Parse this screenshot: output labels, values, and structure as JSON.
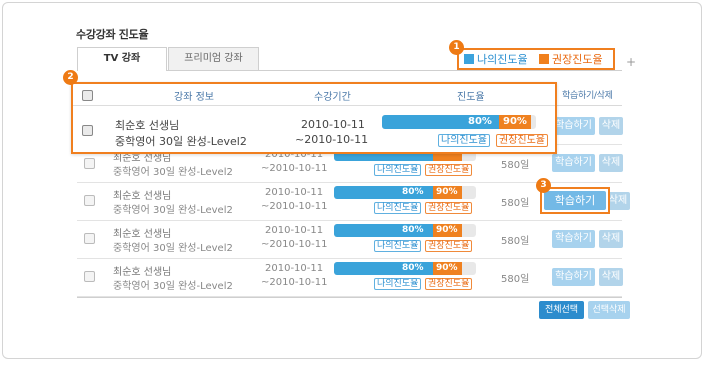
{
  "title": "수강강좌 진도율",
  "tabs": [
    {
      "label": "TV 강좌",
      "active": true
    },
    {
      "label": "프리미엄 강좌",
      "active": false
    }
  ],
  "plus": "+",
  "legend": {
    "my_progress": "나의진도율",
    "recommended_progress": "권장진도율",
    "colors": {
      "my": "#3aa3da",
      "recommended": "#ef8120"
    }
  },
  "badges": [
    "1",
    "2",
    "3"
  ],
  "columns": {
    "info": "강좌 정보",
    "period": "수강기간",
    "progress": "진도율",
    "action": "학습하기/삭제"
  },
  "highlight_row": {
    "teacher": "최순호 선생님",
    "course": "중학영어 30일 완성-Level2",
    "date_start": "2010-10-11",
    "date_end": "~2010-10-11",
    "my_pct": "80%",
    "rec_pct": "90%",
    "my_value": 0.8,
    "rec_value": 0.9,
    "tag_my": "나의진도율",
    "tag_rec": "권장진도율"
  },
  "rows": [
    {
      "teacher": "최순호 선생님",
      "course": "중학영어 30일 완성-Level2",
      "date_start": "2010-10-11",
      "date_end": "~2010-10-11",
      "my_pct": "80%",
      "rec_pct": "90%",
      "tag_my": "나의진도율",
      "tag_rec": "권장진도율",
      "price": "580일",
      "study": "학습하기",
      "delete": "삭제"
    },
    {
      "teacher": "최순호 선생님",
      "course": "중학영어 30일 완성-Level2",
      "date_start": "2010-10-11",
      "date_end": "~2010-10-11",
      "my_pct": "80%",
      "rec_pct": "90%",
      "tag_my": "나의진도율",
      "tag_rec": "권장진도율",
      "price": "580일",
      "study": "학습하기",
      "delete": "삭제"
    },
    {
      "teacher": "최순호 선생님",
      "course": "중학영어 30일 완성-Level2",
      "date_start": "2010-10-11",
      "date_end": "~2010-10-11",
      "my_pct": "80%",
      "rec_pct": "90%",
      "tag_my": "나의진도율",
      "tag_rec": "권장진도율",
      "price": "580일",
      "study": "학습하기",
      "delete": "삭제"
    },
    {
      "teacher": "최순호 선생님",
      "course": "중학영어 30일 완성-Level2",
      "date_start": "2010-10-11",
      "date_end": "~2010-10-11",
      "my_pct": "80%",
      "rec_pct": "90%",
      "tag_my": "나의진도율",
      "tag_rec": "권장진도율",
      "price": "580일",
      "study": "학습하기",
      "delete": "삭제"
    },
    {
      "teacher": "최순호 선생님",
      "course": "중학영어 30일 완성-Level2",
      "date_start": "2010-10-11",
      "date_end": "~2010-10-11",
      "my_pct": "80%",
      "rec_pct": "90%",
      "tag_my": "나의진도율",
      "tag_rec": "권장진도율",
      "price": "580일",
      "study": "학습하기",
      "delete": "삭제"
    }
  ],
  "footer": {
    "select_all": "전체선택",
    "delete_selected": "선택삭제"
  }
}
